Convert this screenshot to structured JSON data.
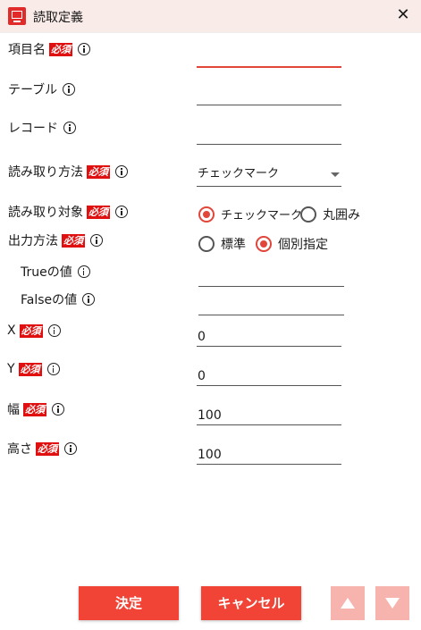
{
  "window": {
    "title": "読取定義",
    "close_icon": "close-icon"
  },
  "labels": {
    "item_name": "項目名",
    "table": "テーブル",
    "record": "レコード",
    "read_method": "読み取り方法",
    "read_target": "読み取り対象",
    "output_method": "出力方法",
    "true_value": "Trueの値",
    "false_value": "Falseの値",
    "x": "X",
    "y": "Y",
    "width": "幅",
    "height": "高さ"
  },
  "required_badge": "必須",
  "fields": {
    "item_name": "",
    "table": "",
    "record": "",
    "read_method": "チェックマーク",
    "true_value": "",
    "false_value": "",
    "x": "0",
    "y": "0",
    "width": "100",
    "height": "100"
  },
  "read_target_options": [
    {
      "label": "チェックマーク",
      "selected": true
    },
    {
      "label": "丸囲み",
      "selected": false
    }
  ],
  "output_method_options": [
    {
      "label": "標準",
      "selected": false
    },
    {
      "label": "個別指定",
      "selected": true
    }
  ],
  "buttons": {
    "ok": "決定",
    "cancel": "キャンセル"
  },
  "colors": {
    "accent": "#f14436",
    "required": "#e01010",
    "titlebar": "#f9ece8",
    "arrow_disabled": "#f7b4ae"
  }
}
